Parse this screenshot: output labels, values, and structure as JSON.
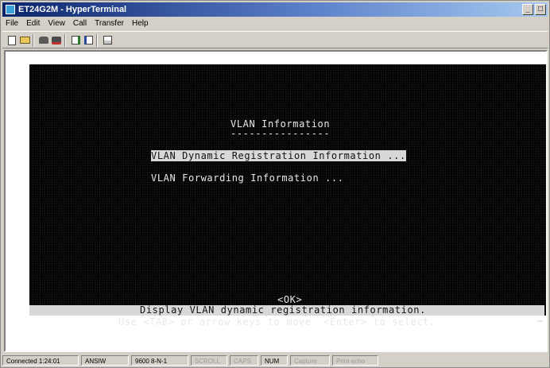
{
  "window": {
    "title": "ET24G2M - HyperTerminal",
    "controls": [
      "_",
      "□"
    ]
  },
  "menu": [
    "File",
    "Edit",
    "View",
    "Call",
    "Transfer",
    "Help"
  ],
  "toolbar": {
    "buttons": [
      "new-document-icon",
      "open-folder-icon",
      "call-icon",
      "hang-up-icon",
      "send-icon",
      "receive-icon",
      "properties-icon"
    ]
  },
  "terminal": {
    "heading": "VLAN Information",
    "heading_underline": "----------------",
    "menu_items": [
      "VLAN Dynamic Registration Information ...",
      "VLAN Forwarding Information ..."
    ],
    "ok_button": "<OK>",
    "description": "Display VLAN dynamic registration information.",
    "help_text": "Use <TAB> or arrow keys to move. <Enter> to select."
  },
  "statusbar": {
    "items": [
      {
        "text": "Connected 1:24:01",
        "dim": false
      },
      {
        "text": "ANSIW",
        "dim": false
      },
      {
        "text": "9600 8-N-1",
        "dim": false
      },
      {
        "text": "SCROLL",
        "dim": true
      },
      {
        "text": "CAPS",
        "dim": true
      },
      {
        "text": "NUM",
        "dim": false
      },
      {
        "text": "Capture",
        "dim": true
      },
      {
        "text": "Print echo",
        "dim": true
      }
    ]
  }
}
